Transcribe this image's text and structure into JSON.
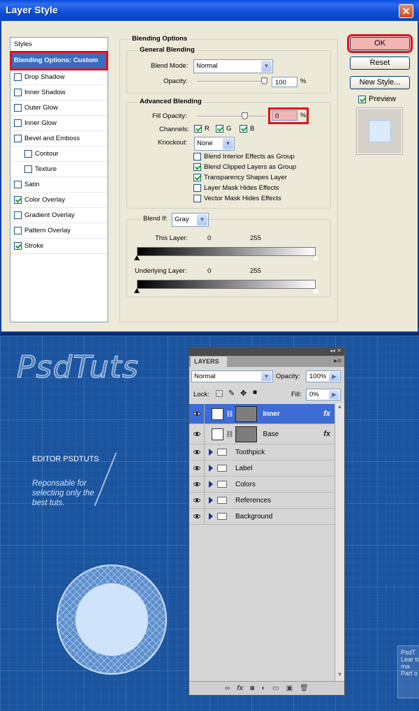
{
  "dialog": {
    "title": "Layer Style",
    "close_glyph": "✕",
    "styles_header": "Styles",
    "style_items": [
      {
        "label": "Blending Options: Custom",
        "checkbox": false,
        "checked": false,
        "indent": false,
        "selected": true
      },
      {
        "label": "Drop Shadow",
        "checkbox": true,
        "checked": false,
        "indent": false
      },
      {
        "label": "Inner Shadow",
        "checkbox": true,
        "checked": false,
        "indent": false
      },
      {
        "label": "Outer Glow",
        "checkbox": true,
        "checked": false,
        "indent": false
      },
      {
        "label": "Inner Glow",
        "checkbox": true,
        "checked": false,
        "indent": false
      },
      {
        "label": "Bevel and Emboss",
        "checkbox": true,
        "checked": false,
        "indent": false
      },
      {
        "label": "Contour",
        "checkbox": true,
        "checked": false,
        "indent": true
      },
      {
        "label": "Texture",
        "checkbox": true,
        "checked": false,
        "indent": true
      },
      {
        "label": "Satin",
        "checkbox": true,
        "checked": false,
        "indent": false
      },
      {
        "label": "Color Overlay",
        "checkbox": true,
        "checked": true,
        "indent": false
      },
      {
        "label": "Gradient Overlay",
        "checkbox": true,
        "checked": false,
        "indent": false
      },
      {
        "label": "Pattern Overlay",
        "checkbox": true,
        "checked": false,
        "indent": false
      },
      {
        "label": "Stroke",
        "checkbox": true,
        "checked": true,
        "indent": false
      }
    ],
    "blending_options_title": "Blending Options",
    "general_blending_title": "General Blending",
    "blend_mode_label": "Blend Mode:",
    "blend_mode_value": "Normal",
    "opacity_label": "Opacity:",
    "opacity_value": "100",
    "percent": "%",
    "advanced_blending_title": "Advanced Blending",
    "fill_opacity_label": "Fill Opacity:",
    "fill_opacity_value": "0",
    "channels_label": "Channels:",
    "channel_r": "R",
    "channel_g": "G",
    "channel_b": "B",
    "knockout_label": "Knockout:",
    "knockout_value": "None",
    "advanced_checks": [
      {
        "label": "Blend Interior Effects as Group",
        "checked": false
      },
      {
        "label": "Blend Clipped Layers as Group",
        "checked": true
      },
      {
        "label": "Transparency Shapes Layer",
        "checked": true
      },
      {
        "label": "Layer Mask Hides Effects",
        "checked": false
      },
      {
        "label": "Vector Mask Hides Effects",
        "checked": false
      }
    ],
    "blend_if_label": "Blend If:",
    "blend_if_value": "Gray",
    "this_layer_label": "This Layer:",
    "this_layer_low": "0",
    "this_layer_high": "255",
    "underlying_label": "Underlying Layer:",
    "underlying_low": "0",
    "underlying_high": "255",
    "ok_label": "OK",
    "reset_label": "Reset",
    "new_style_label": "New Style...",
    "preview_label": "Preview",
    "preview_checked": true
  },
  "canvas": {
    "brand": "PsdTuts",
    "editor_title": "EDITOR PSDTUTS",
    "editor_desc": "Reponsable for selecting only the best tuts.",
    "side_card_text": "PsdT Lear to ma Part o"
  },
  "layers_panel": {
    "tab_label": "LAYERS",
    "blend_mode": "Normal",
    "opacity_label": "Opacity:",
    "opacity_value": "100%",
    "lock_label": "Lock:",
    "fill_label": "Fill:",
    "fill_value": "0%",
    "fx_glyph": "fx",
    "layers": [
      {
        "name": "Inner",
        "type": "layer",
        "selected": true,
        "has_fx": true
      },
      {
        "name": "Base",
        "type": "layer",
        "selected": false,
        "has_fx": true
      },
      {
        "name": "Toothpick",
        "type": "group",
        "selected": false,
        "has_fx": false
      },
      {
        "name": "Label",
        "type": "group",
        "selected": false,
        "has_fx": false
      },
      {
        "name": "Colors",
        "type": "group",
        "selected": false,
        "has_fx": false
      },
      {
        "name": "References",
        "type": "group",
        "selected": false,
        "has_fx": false
      },
      {
        "name": "Background",
        "type": "group",
        "selected": false,
        "has_fx": false
      }
    ],
    "bottom_icons": [
      "link-icon",
      "fx-icon",
      "mask-icon",
      "adjustment-icon",
      "group-icon",
      "new-layer-icon",
      "trash-icon"
    ]
  },
  "colors": {
    "selection_red": "#e0101a",
    "xp_blue": "#0a4ee0",
    "layer_selected": "#3d6cd5",
    "blueprint": "#1b55a0"
  }
}
